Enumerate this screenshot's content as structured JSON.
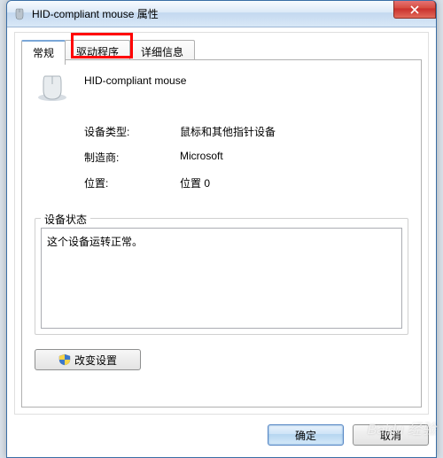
{
  "window": {
    "title": "HID-compliant mouse 属性"
  },
  "tabs": {
    "general": "常规",
    "driver": "驱动程序",
    "details": "详细信息"
  },
  "device": {
    "name": "HID-compliant mouse",
    "type_label": "设备类型:",
    "type_value": "鼠标和其他指针设备",
    "mfr_label": "制造商:",
    "mfr_value": "Microsoft",
    "loc_label": "位置:",
    "loc_value": "位置 0"
  },
  "status": {
    "group_title": "设备状态",
    "text": "这个设备运转正常。"
  },
  "buttons": {
    "change": "改变设置",
    "ok": "确定",
    "cancel": "取消"
  },
  "watermark": "Baidu 经验"
}
